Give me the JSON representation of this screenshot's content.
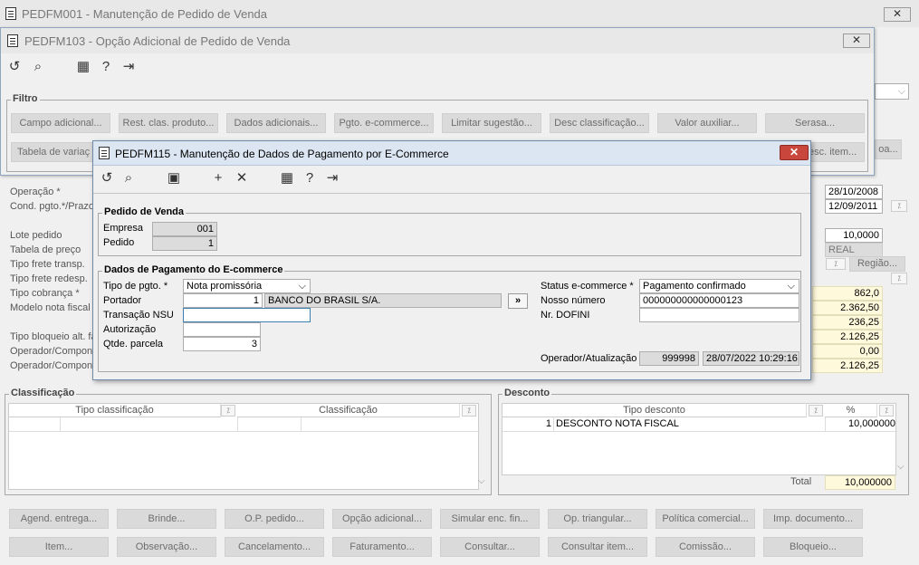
{
  "main_window": {
    "title": "PEDFM001 - Manutenção de Pedido de Venda",
    "close": "✕",
    "labels": [
      "Operação *",
      "Cond. pgto.*/Prazo",
      "Lote pedido",
      "Tabela de preço",
      "Tipo frete transp.",
      "Tipo frete redesp.",
      "Tipo cobrança *",
      "Modelo nota fiscal",
      "Tipo bloqueio alt. fa",
      "Operador/Compone",
      "Operador/Compone"
    ],
    "right_values": {
      "date1": "28/10/2008",
      "date2": "12/09/2011",
      "lote": "10,0000",
      "moeda": "REAL",
      "regiao": "Região...",
      "v1": "862,0",
      "v2": "2.362,50",
      "v3": "236,25",
      "v4": "2.126,25",
      "v5": "0,00",
      "v6": "2.126,25"
    },
    "classificacao": {
      "title": "Classificação",
      "columns": [
        "Tipo classificação",
        "Classificação"
      ]
    },
    "desconto": {
      "title": "Desconto",
      "columns": [
        "Tipo desconto",
        "%"
      ],
      "rows": [
        {
          "num": "1",
          "tipo": "DESCONTO NOTA FISCAL",
          "pct": "10,000000"
        }
      ],
      "total_label": "Total",
      "total_value": "10,000000"
    },
    "buttons_row1": [
      "Agend. entrega...",
      "Brinde...",
      "O.P. pedido...",
      "Opção adicional...",
      "Simular enc. fin...",
      "Op. triangular...",
      "Política comercial...",
      "Imp. documento..."
    ],
    "buttons_row2": [
      "Item...",
      "Observação...",
      "Cancelamento...",
      "Faturamento...",
      "Consultar...",
      "Consultar item...",
      "Comissão...",
      "Bloqueio..."
    ]
  },
  "mid_window": {
    "title": "PEDFM103 - Opção Adicional de Pedido de Venda",
    "close": "✕",
    "filtro": {
      "title": "Filtro",
      "row1": [
        "Campo adicional...",
        "Rest. clas. produto...",
        "Dados adicionais...",
        "Pgto. e-commerce...",
        "Limitar sugestão...",
        "Desc classificação...",
        "Valor auxiliar...",
        "Serasa..."
      ],
      "row2_left": "Tabela de variaç",
      "row2_right": "esc. item...",
      "extra": "oa..."
    }
  },
  "dialog": {
    "title": "PEDFM115 - Manutenção de Dados de Pagamento por E-Commerce",
    "close": "✕",
    "pedido": {
      "title": "Pedido de Venda",
      "empresa_label": "Empresa",
      "empresa": "001",
      "pedido_label": "Pedido",
      "pedido": "1"
    },
    "dados": {
      "title": "Dados de Pagamento do E-commerce",
      "tipo_pgto_label": "Tipo de pgto. *",
      "tipo_pgto": "Nota promissória",
      "portador_label": "Portador",
      "portador_code": "1",
      "portador_name": "BANCO DO BRASIL S/A.",
      "lookup": "»",
      "nsu_label": "Transação NSU",
      "nsu": "",
      "autorizacao_label": "Autorização",
      "autorizacao": "",
      "parcelas_label": "Qtde. parcela",
      "parcelas": "3",
      "status_label": "Status e-commerce *",
      "status": "Pagamento confirmado",
      "nosso_label": "Nosso número",
      "nosso": "000000000000000123",
      "dofini_label": "Nr. DOFINI",
      "dofini": "",
      "operador_label": "Operador/Atualização",
      "operador": "999998",
      "atualizacao": "28/07/2022 10:29:16"
    }
  },
  "colors": {
    "accent_close": "#c9463d",
    "title_text": "#000000",
    "readonly_bg": "#dcdcdc",
    "highlight_bg": "#fff9dc"
  },
  "icons": [
    "undo-icon",
    "search-icon",
    "calendar-icon",
    "help-icon",
    "exit-icon",
    "save-icon",
    "add-icon",
    "delete-icon"
  ]
}
